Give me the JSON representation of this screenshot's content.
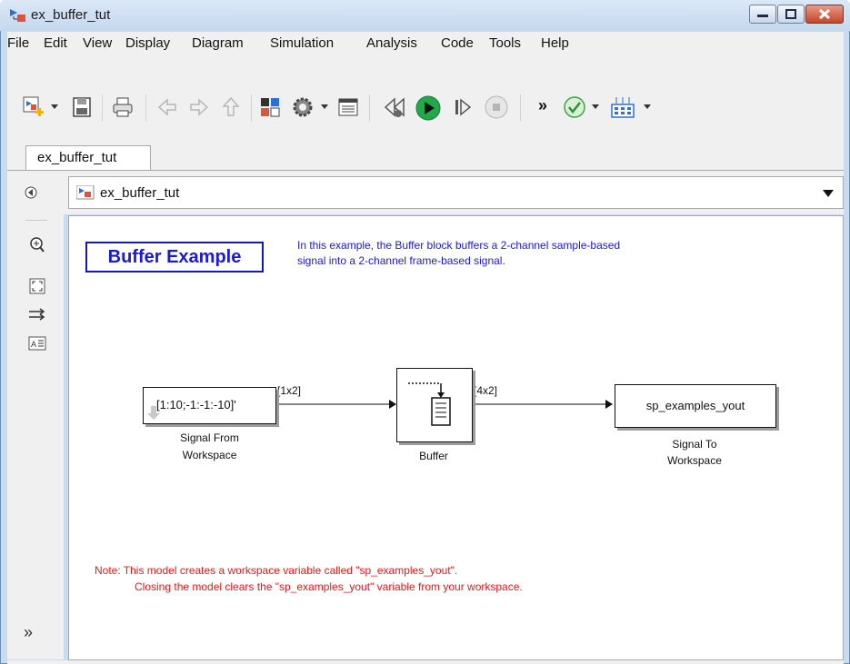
{
  "window": {
    "title": "ex_buffer_tut"
  },
  "menu": [
    "File",
    "Edit",
    "View",
    "Display",
    "Diagram",
    "Simulation",
    "Analysis",
    "Code",
    "Tools",
    "Help"
  ],
  "toolbar": {
    "icons": [
      "new-model-icon",
      "save-icon",
      "print-icon",
      "back-icon",
      "forward-icon",
      "up-icon",
      "library-browser-icon",
      "model-settings-icon",
      "model-explorer-icon",
      "step-back-icon",
      "run-icon",
      "step-forward-icon",
      "stop-icon",
      "more-icon",
      "check-icon",
      "build-icon"
    ],
    "overflow_label": "»"
  },
  "tabs": [
    {
      "label": "ex_buffer_tut"
    }
  ],
  "address": {
    "path": "ex_buffer_tut"
  },
  "palette": {
    "expand_label": "»"
  },
  "canvas": {
    "title": "Buffer Example",
    "description": [
      "In this example, the Buffer block buffers a 2-channel sample-based",
      "signal into a 2-channel frame-based signal."
    ],
    "blocks": {
      "source": {
        "content": "[1:10;-1:-1:-10]'",
        "label": [
          "Signal From",
          "Workspace"
        ]
      },
      "buffer": {
        "label": "Buffer"
      },
      "sink": {
        "content": "sp_examples_yout",
        "label": [
          "Signal To",
          "Workspace"
        ]
      }
    },
    "signals": {
      "source_out": "[1x2]",
      "buffer_out": "[4x2]"
    },
    "note": [
      "Note: This model creates a workspace variable called \"sp_examples_yout\".",
      "Closing the model clears the \"sp_examples_yout\" variable from your workspace."
    ]
  },
  "colors": {
    "annotation_blue": "#1a1ad2",
    "note_red": "#e01b1b",
    "run_green": "#22a84a"
  }
}
